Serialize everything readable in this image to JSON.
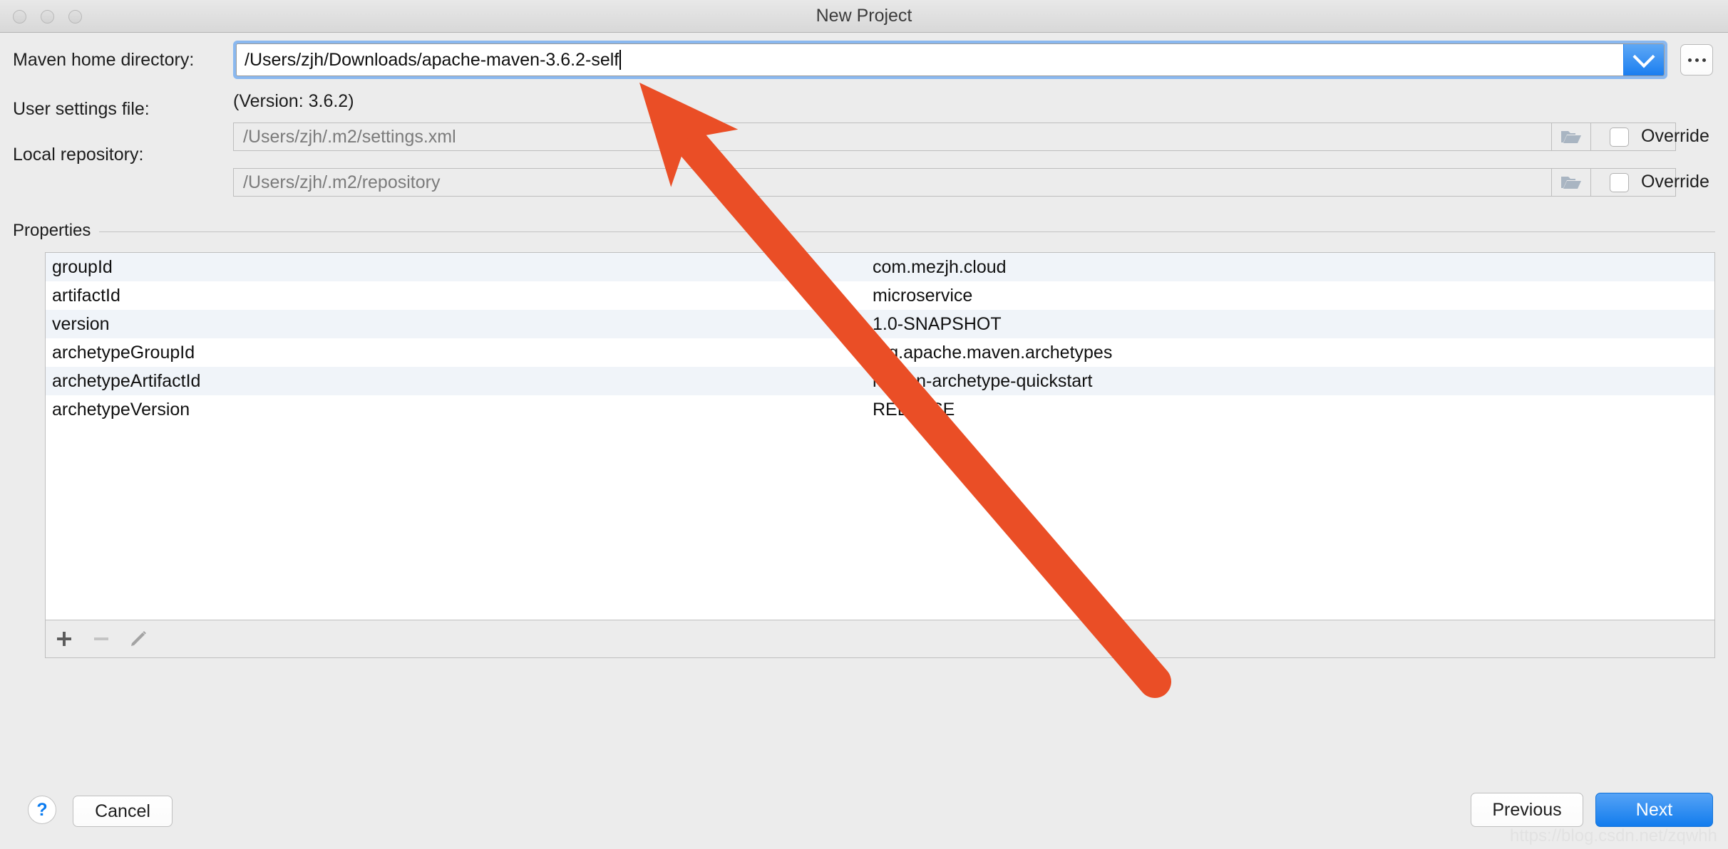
{
  "window": {
    "title": "New Project",
    "traffic_lights": [
      "close",
      "minimize",
      "maximize"
    ]
  },
  "form": {
    "maven_home": {
      "label": "Maven home directory:",
      "value": "/Users/zjh/Downloads/apache-maven-3.6.2-self",
      "version_note": "(Version: 3.6.2)",
      "browse_label": "...",
      "dropdown_icon": "chevron-down-icon",
      "focused": true
    },
    "user_settings": {
      "label": "User settings file:",
      "value": "/Users/zjh/.m2/settings.xml",
      "override_label": "Override",
      "override_checked": false,
      "enabled": false,
      "browse_icon": "folder-icon"
    },
    "local_repository": {
      "label": "Local repository:",
      "value": "/Users/zjh/.m2/repository",
      "override_label": "Override",
      "override_checked": false,
      "enabled": false,
      "browse_icon": "folder-icon"
    }
  },
  "properties": {
    "group_title": "Properties",
    "rows": [
      {
        "key": "groupId",
        "value": "com.mezjh.cloud"
      },
      {
        "key": "artifactId",
        "value": "microservice"
      },
      {
        "key": "version",
        "value": "1.0-SNAPSHOT"
      },
      {
        "key": "archetypeGroupId",
        "value": "org.apache.maven.archetypes"
      },
      {
        "key": "archetypeArtifactId",
        "value": "maven-archetype-quickstart"
      },
      {
        "key": "archetypeVersion",
        "value": "RELEASE"
      }
    ],
    "toolbar": {
      "add_icon": "plus-icon",
      "remove_icon": "minus-icon",
      "edit_icon": "pencil-icon"
    }
  },
  "footer": {
    "help_label": "?",
    "cancel_label": "Cancel",
    "previous_label": "Previous",
    "next_label": "Next"
  },
  "annotation": {
    "type": "arrow",
    "color": "#EA4E26",
    "points_to": "maven home directory field"
  },
  "watermark": "https://blog.csdn.net/zqwhh",
  "colors": {
    "dialog_bg": "#ECECEC",
    "accent_blue": "#127CED",
    "focus_ring": "#8AB8EF",
    "row_stripe": "#F0F4F9",
    "annotation_red": "#EA4E26"
  }
}
